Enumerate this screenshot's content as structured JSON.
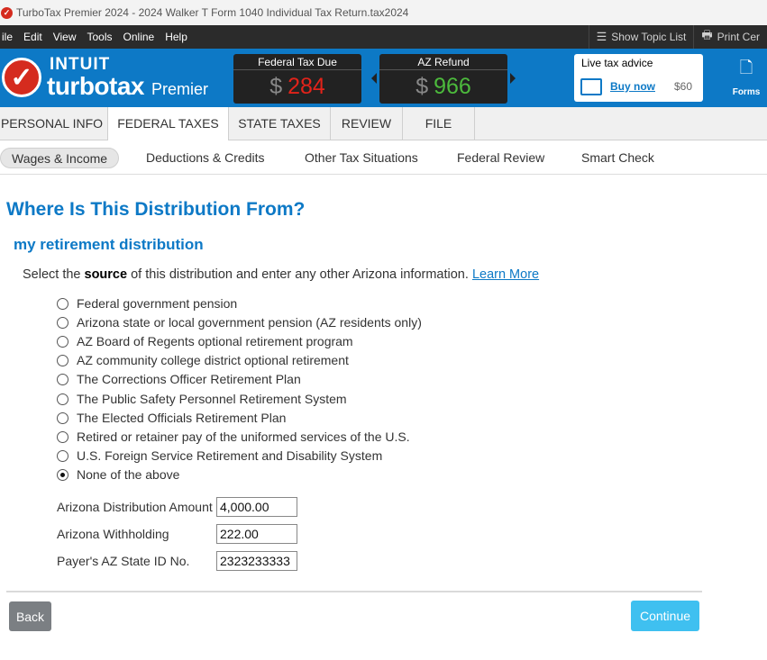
{
  "window": {
    "title": "TurboTax Premier 2024 - 2024 Walker T Form 1040  Individual Tax Return.tax2024",
    "app_icon": "turbotax-check-icon"
  },
  "menubar": {
    "items": [
      "ile",
      "Edit",
      "View",
      "Tools",
      "Online",
      "Help"
    ],
    "show_topic_list": "Show Topic List",
    "print_center": "Print Cer"
  },
  "brand": {
    "intuit": "INTUIT",
    "turbotax": "turbotax",
    "edition": "Premier"
  },
  "meters": {
    "federal": {
      "label": "Federal Tax Due",
      "currency": "$",
      "value": "284"
    },
    "state": {
      "label": "AZ Refund",
      "currency": "$",
      "value": "966"
    }
  },
  "advice": {
    "title": "Live tax advice",
    "buy_now": "Buy now",
    "price": "$60"
  },
  "forms": {
    "label": "Forms"
  },
  "tabs": [
    {
      "label": "PERSONAL INFO"
    },
    {
      "label": "FEDERAL TAXES"
    },
    {
      "label": "STATE TAXES"
    },
    {
      "label": "REVIEW"
    },
    {
      "label": "FILE"
    }
  ],
  "subnav": [
    {
      "label": "Wages & Income"
    },
    {
      "label": "Deductions & Credits"
    },
    {
      "label": "Other Tax Situations"
    },
    {
      "label": "Federal Review"
    },
    {
      "label": "Smart Check"
    }
  ],
  "main": {
    "title": "Where Is This Distribution From?",
    "subtitle": "my retirement distribution",
    "instruction_pre": "Select the ",
    "instruction_bold": "source",
    "instruction_post": " of this distribution and enter any other Arizona information. ",
    "learn_more": "Learn More",
    "options": [
      {
        "label": "Federal government pension",
        "checked": false
      },
      {
        "label": "Arizona state or local government pension (AZ residents only)",
        "checked": false
      },
      {
        "label": "AZ Board of Regents optional retirement program",
        "checked": false
      },
      {
        "label": "AZ community college district optional retirement",
        "checked": false
      },
      {
        "label": "The Corrections Officer Retirement Plan",
        "checked": false
      },
      {
        "label": "The Public Safety Personnel Retirement System",
        "checked": false
      },
      {
        "label": "The Elected Officials Retirement Plan",
        "checked": false
      },
      {
        "label": "Retired or retainer pay of the uniformed services of the U.S.",
        "checked": false
      },
      {
        "label": "U.S. Foreign Service Retirement and Disability System",
        "checked": false
      },
      {
        "label": "None of the above",
        "checked": true
      }
    ],
    "fields": [
      {
        "label": "Arizona Distribution Amount",
        "value": "4,000.00"
      },
      {
        "label": "Arizona Withholding",
        "value": "222.00"
      },
      {
        "label": "Payer's AZ State ID No.",
        "value": "2323233333"
      }
    ]
  },
  "footer": {
    "back": "Back",
    "continue": "Continue"
  },
  "colors": {
    "brand_blue": "#0d79c6",
    "due_red": "#e2231a",
    "refund_green": "#4cba3c",
    "continue_blue": "#3fc0f0"
  }
}
